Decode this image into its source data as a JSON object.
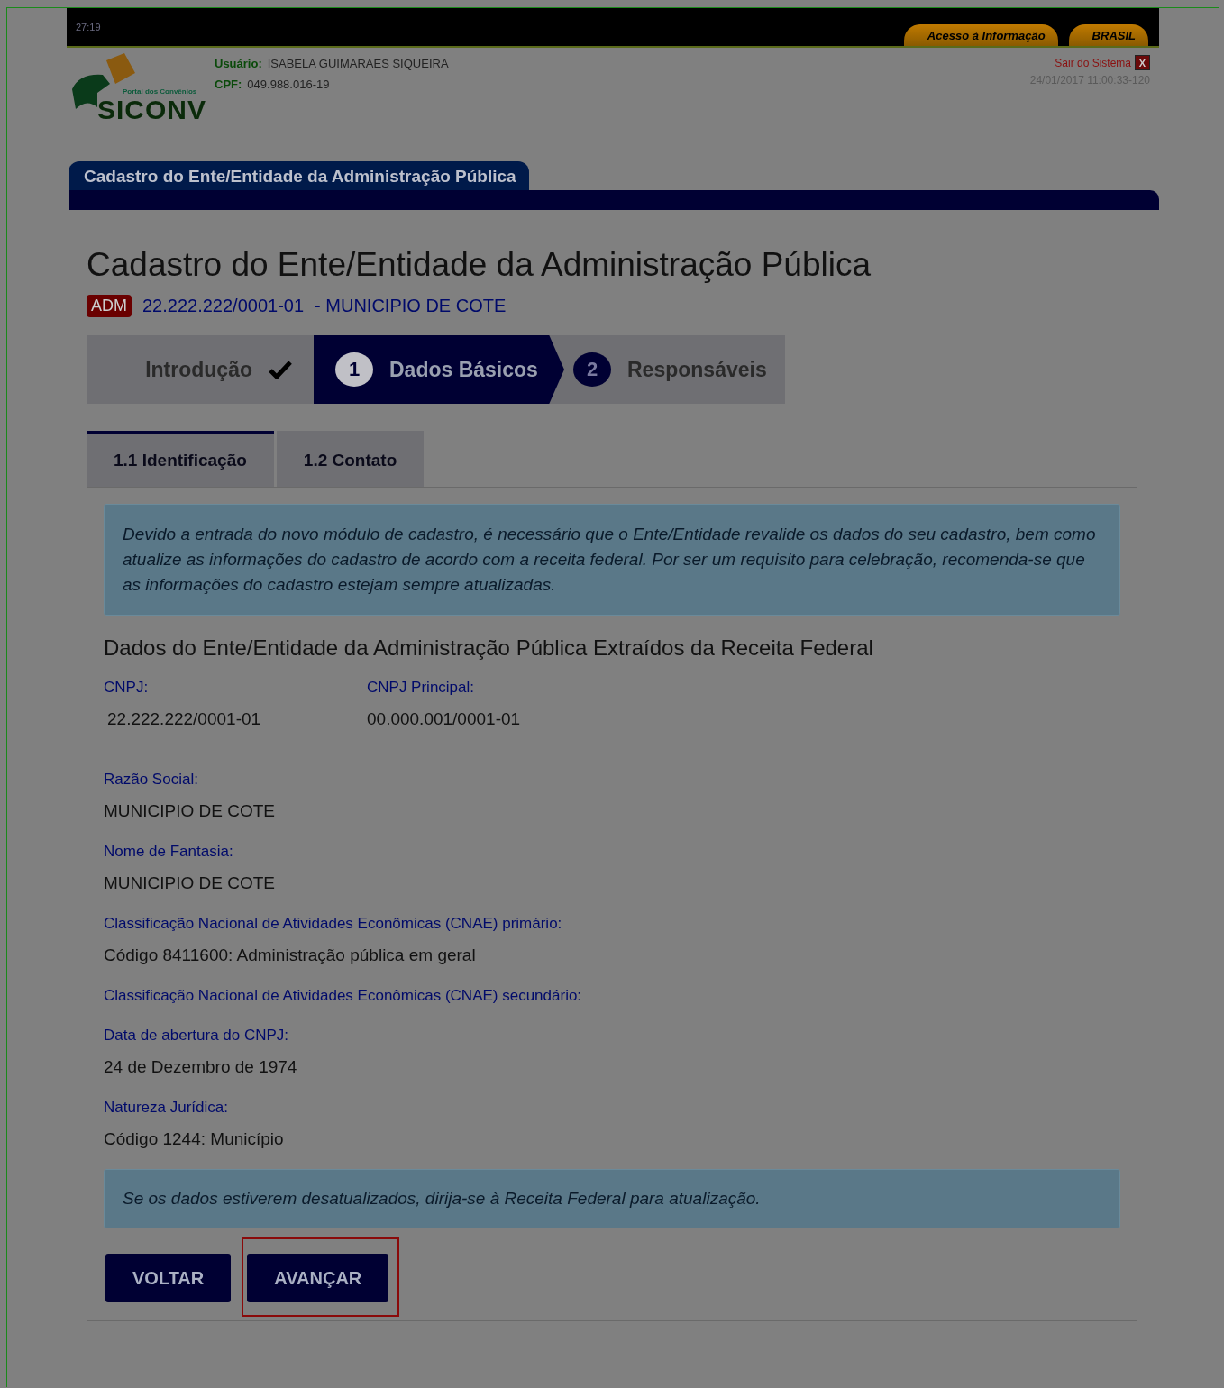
{
  "top_bar": {
    "clock": "27:19",
    "links": [
      "Acesso à Informação",
      "BRASIL"
    ]
  },
  "header": {
    "logo_tagline": "Portal dos Convênios",
    "logo_name": "SICONV",
    "user_label": "Usuário:",
    "user": "ISABELA GUIMARAES SIQUEIRA",
    "cpf_label": "CPF:",
    "cpf": "049.988.016-19",
    "logout": "Sair do Sistema",
    "close_glyph": "X",
    "timestamp": "24/01/2017 11:00:33-120"
  },
  "section_tab": "Cadastro do Ente/Entidade da Administração Pública",
  "page_title": "Cadastro do Ente/Entidade da Administração Pública",
  "entity": {
    "badge": "ADM",
    "cnpj": "22.222.222/0001-01",
    "name": "- MUNICIPIO DE COTE"
  },
  "steps": [
    {
      "kind": "done",
      "label": "Introdução",
      "selected": false
    },
    {
      "kind": "current",
      "number": "1",
      "label": "Dados Básicos",
      "selected": true
    },
    {
      "kind": "pending",
      "number": "2",
      "label": "Responsáveis",
      "selected": false
    }
  ],
  "tabs": [
    {
      "label": "1.1 Identificação",
      "selected": true
    },
    {
      "label": "1.2 Contato",
      "selected": false
    }
  ],
  "notice": "Devido a entrada do novo módulo de cadastro, é necessário que o Ente/Entidade revalide os dados do seu cadastro, bem como atualize as informações do cadastro de acordo com a receita federal. Por ser um requisito para celebração, recomenda-se que as informações do cadastro estejam sempre atualizadas.",
  "section_title": "Dados do Ente/Entidade da Administração Pública Extraídos da Receita Federal",
  "cnpj_fields": [
    {
      "label": "CNPJ:",
      "value": "22.222.222/0001-01"
    },
    {
      "label": "CNPJ Principal:",
      "value": "00.000.001/0001-01"
    }
  ],
  "fields": [
    {
      "label": "Razão Social:",
      "value": "MUNICIPIO DE COTE"
    },
    {
      "label": "Nome de Fantasia:",
      "value": "MUNICIPIO DE COTE"
    },
    {
      "label": "Classificação Nacional de Atividades Econômicas (CNAE) primário:",
      "value": "Código 8411600: Administração pública em geral"
    },
    {
      "label": "Classificação Nacional de Atividades Econômicas (CNAE) secundário:"
    },
    {
      "label": "Data de abertura do CNPJ:",
      "value": "24 de Dezembro de 1974"
    },
    {
      "label": "Natureza Jurídica:",
      "value": "Código 1244: Município"
    }
  ],
  "footer_notice": "Se os dados estiverem desatualizados, dirija-se à Receita Federal para atualização.",
  "buttons": [
    {
      "label": "VOLTAR",
      "highlighted": false
    },
    {
      "label": "AVANÇAR",
      "highlighted": true
    }
  ]
}
